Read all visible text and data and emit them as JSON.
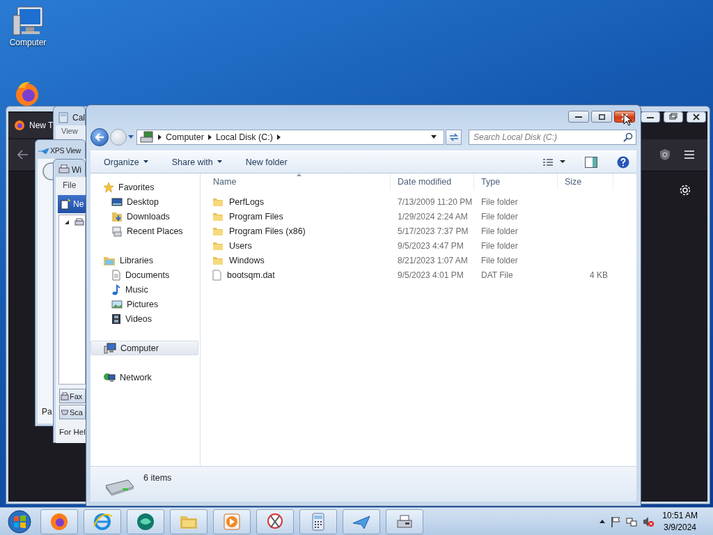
{
  "desktop_icons": [
    {
      "label": "Computer"
    }
  ],
  "background_windows": [
    {
      "kind": "browser",
      "tab": "New T"
    },
    {
      "kind": "calculator",
      "title": "Cal",
      "menu": [
        "View"
      ]
    },
    {
      "kind": "viewer",
      "title": "XPS View",
      "status": "Pa"
    },
    {
      "kind": "fax",
      "title": "Wi",
      "menu": [
        "File"
      ],
      "toolbar_item": "Ne",
      "nav": [
        "Fax",
        "Sca"
      ],
      "status": "For Hel"
    }
  ],
  "explorer": {
    "breadcrumb": [
      "Computer",
      "Local Disk (C:)"
    ],
    "search": {
      "placeholder": "Search Local Disk (C:)"
    },
    "toolbar": [
      {
        "label": "Organize",
        "dropdown": true
      },
      {
        "label": "Share with",
        "dropdown": true
      },
      {
        "label": "New folder",
        "dropdown": false
      }
    ],
    "sidebar": [
      {
        "label": "Favorites",
        "kind": "favorites",
        "selected": false,
        "children": [
          {
            "label": "Desktop",
            "kind": "desktop",
            "selected": false
          },
          {
            "label": "Downloads",
            "kind": "downloads",
            "selected": false
          },
          {
            "label": "Recent Places",
            "kind": "recent",
            "selected": false
          }
        ]
      },
      {
        "label": "Libraries",
        "kind": "libraries",
        "selected": false,
        "children": [
          {
            "label": "Documents",
            "kind": "documents",
            "selected": false
          },
          {
            "label": "Music",
            "kind": "music",
            "selected": false
          },
          {
            "label": "Pictures",
            "kind": "pictures",
            "selected": false
          },
          {
            "label": "Videos",
            "kind": "videos",
            "selected": false
          }
        ]
      },
      {
        "label": "Computer",
        "kind": "computer",
        "selected": true
      },
      {
        "label": "Network",
        "kind": "network",
        "selected": false
      }
    ],
    "columns": [
      "Name",
      "Date modified",
      "Type",
      "Size"
    ],
    "rows": [
      {
        "kind": "folder",
        "name": "PerfLogs",
        "date": "7/13/2009 11:20 PM",
        "type": "File folder"
      },
      {
        "kind": "folder",
        "name": "Program Files",
        "date": "1/29/2024 2:24 AM",
        "type": "File folder"
      },
      {
        "kind": "folder",
        "name": "Program Files (x86)",
        "date": "5/17/2023 7:37 PM",
        "type": "File folder"
      },
      {
        "kind": "folder",
        "name": "Users",
        "date": "9/5/2023 4:47 PM",
        "type": "File folder"
      },
      {
        "kind": "folder",
        "name": "Windows",
        "date": "8/21/2023 1:07 AM",
        "type": "File folder"
      },
      {
        "kind": "file",
        "name": "bootsqm.dat",
        "date": "9/5/2023 4:01 PM",
        "type": "DAT File",
        "size": "4 KB"
      }
    ],
    "status": "6 items"
  },
  "taskbar": {
    "time": "10:51 AM",
    "date": "3/9/2024"
  }
}
